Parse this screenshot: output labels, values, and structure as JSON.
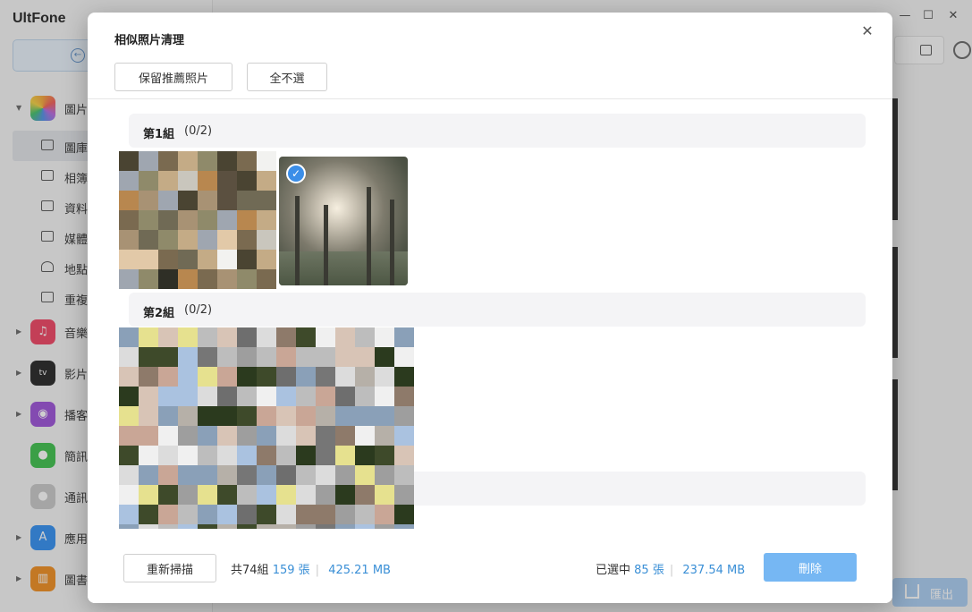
{
  "app": {
    "brand": "UltFone",
    "sidebar": {
      "items": [
        {
          "label": "圖片",
          "icon": "photos-icon",
          "color": "#f4a338"
        },
        {
          "label": "音樂",
          "icon": "music-icon",
          "color": "#f04060"
        },
        {
          "label": "影片",
          "icon": "appletv-icon",
          "color": "#222222"
        },
        {
          "label": "播客",
          "icon": "podcasts-icon",
          "color": "#9b4fd8"
        },
        {
          "label": "簡訊",
          "icon": "messages-icon",
          "color": "#3bc14a"
        },
        {
          "label": "通訊",
          "icon": "contacts-icon",
          "color": "#b5b5b5"
        },
        {
          "label": "應用",
          "icon": "appstore-icon",
          "color": "#2f8ef2"
        },
        {
          "label": "圖書",
          "icon": "books-icon",
          "color": "#f08c1c"
        }
      ],
      "sub_items": [
        "圖庫",
        "相簿",
        "資料",
        "媒體",
        "地點",
        "重複"
      ]
    },
    "export_label": "匯出"
  },
  "modal": {
    "title": "相似照片清理",
    "keep_recommended_label": "保留推薦照片",
    "deselect_all_label": "全不選",
    "groups": [
      {
        "name": "第1組",
        "count": "(0/2)"
      },
      {
        "name": "第2組",
        "count": "(0/2)"
      }
    ],
    "footer": {
      "rescan_label": "重新掃描",
      "total_groups": "共74組",
      "total_photos_num": "159",
      "photos_unit": "張",
      "total_size": "425.21 MB",
      "selected_label": "已選中",
      "selected_num": "85",
      "selected_size": "237.54 MB",
      "delete_label": "刪除"
    }
  },
  "colors": {
    "accent": "#3a8fd6",
    "delete_button": "#76b7f3",
    "check": "#3b8ee8"
  }
}
